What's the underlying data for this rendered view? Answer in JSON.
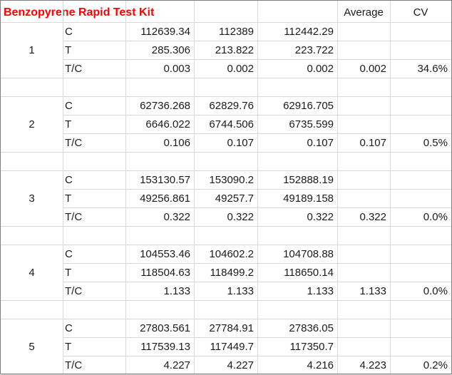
{
  "title": "Benzopyrene Rapid Test Kit",
  "headers": {
    "average": "Average",
    "cv": "CV"
  },
  "groups": [
    {
      "id": "1",
      "rows": [
        {
          "label": "C",
          "values": [
            "112639.34",
            "112389",
            "112442.29"
          ],
          "average": "",
          "cv": ""
        },
        {
          "label": "T",
          "values": [
            "285.306",
            "213.822",
            "223.722"
          ],
          "average": "",
          "cv": ""
        },
        {
          "label": "T/C",
          "values": [
            "0.003",
            "0.002",
            "0.002"
          ],
          "average": "0.002",
          "cv": "34.6%"
        }
      ]
    },
    {
      "id": "2",
      "rows": [
        {
          "label": "C",
          "values": [
            "62736.268",
            "62829.76",
            "62916.705"
          ],
          "average": "",
          "cv": ""
        },
        {
          "label": "T",
          "values": [
            "6646.022",
            "6744.506",
            "6735.599"
          ],
          "average": "",
          "cv": ""
        },
        {
          "label": "T/C",
          "values": [
            "0.106",
            "0.107",
            "0.107"
          ],
          "average": "0.107",
          "cv": "0.5%"
        }
      ]
    },
    {
      "id": "3",
      "rows": [
        {
          "label": "C",
          "values": [
            "153130.57",
            "153090.2",
            "152888.19"
          ],
          "average": "",
          "cv": ""
        },
        {
          "label": "T",
          "values": [
            "49256.861",
            "49257.7",
            "49189.158"
          ],
          "average": "",
          "cv": ""
        },
        {
          "label": "T/C",
          "values": [
            "0.322",
            "0.322",
            "0.322"
          ],
          "average": "0.322",
          "cv": "0.0%"
        }
      ]
    },
    {
      "id": "4",
      "rows": [
        {
          "label": "C",
          "values": [
            "104553.46",
            "104602.2",
            "104708.88"
          ],
          "average": "",
          "cv": ""
        },
        {
          "label": "T",
          "values": [
            "118504.63",
            "118499.2",
            "118650.14"
          ],
          "average": "",
          "cv": ""
        },
        {
          "label": "T/C",
          "values": [
            "1.133",
            "1.133",
            "1.133"
          ],
          "average": "1.133",
          "cv": "0.0%"
        }
      ]
    },
    {
      "id": "5",
      "rows": [
        {
          "label": "C",
          "values": [
            "27803.561",
            "27784.91",
            "27836.05"
          ],
          "average": "",
          "cv": ""
        },
        {
          "label": "T",
          "values": [
            "117539.13",
            "117449.7",
            "117350.7"
          ],
          "average": "",
          "cv": ""
        },
        {
          "label": "T/C",
          "values": [
            "4.227",
            "4.227",
            "4.216"
          ],
          "average": "4.223",
          "cv": "0.2%"
        }
      ]
    }
  ]
}
